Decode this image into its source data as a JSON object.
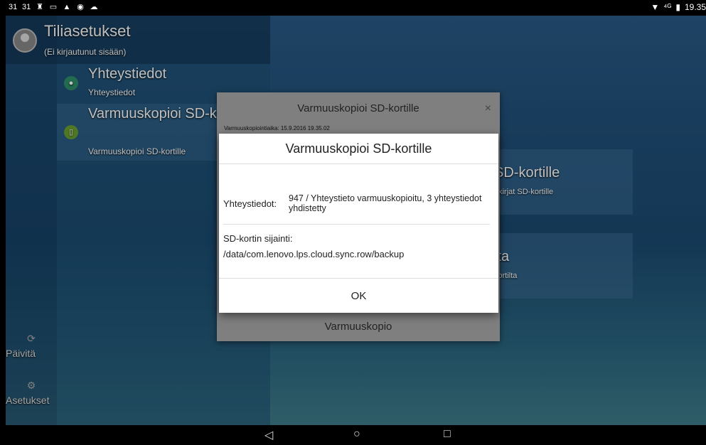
{
  "status_bar": {
    "left_icons": [
      "31",
      "31",
      "♜",
      "▭",
      "▲",
      "◉",
      "☁"
    ],
    "signal": "⁴ᴳ",
    "time": "19.35"
  },
  "account": {
    "title": "Tiliasetukset",
    "subtitle": "(Ei kirjautunut sisään)"
  },
  "menu": {
    "items": [
      {
        "title": "Yhteystiedot",
        "subtitle": "Yhteystiedot",
        "icon": "person-icon",
        "color": "#2f8f6a"
      },
      {
        "title": "Varmuuskopioi SD-kortille",
        "subtitle": "Varmuuskopioi SD-kortille",
        "icon": "sd-card-icon",
        "color": "#6aa030"
      }
    ]
  },
  "rail": {
    "refresh_label": "Päivitä",
    "settings_label": "Asetukset"
  },
  "cards": [
    {
      "title": "SD-kortille",
      "subtitle": "akirjat SD-kortille"
    },
    {
      "title": "lta",
      "subtitle": "kortilta"
    }
  ],
  "background_dialog": {
    "title": "Varmuuskopioi SD-kortille",
    "close": "×",
    "backup_time": "Varmuuskopiointiaika: 15.9.2016 19.35.02",
    "footer_button": "Varmuuskopio"
  },
  "dialog": {
    "title": "Varmuuskopioi SD-kortille",
    "contacts_label": "Yhteystiedot:",
    "contacts_value": "947 / Yhteystieto varmuuskopioitu, 3 yhteystiedot yhdistetty",
    "location_label": "SD-kortin sijainti:",
    "location_value": "/data/com.lenovo.lps.cloud.sync.row/backup",
    "ok_label": "OK"
  },
  "navbar": {
    "back": "◁",
    "home": "○",
    "recents": "□"
  }
}
